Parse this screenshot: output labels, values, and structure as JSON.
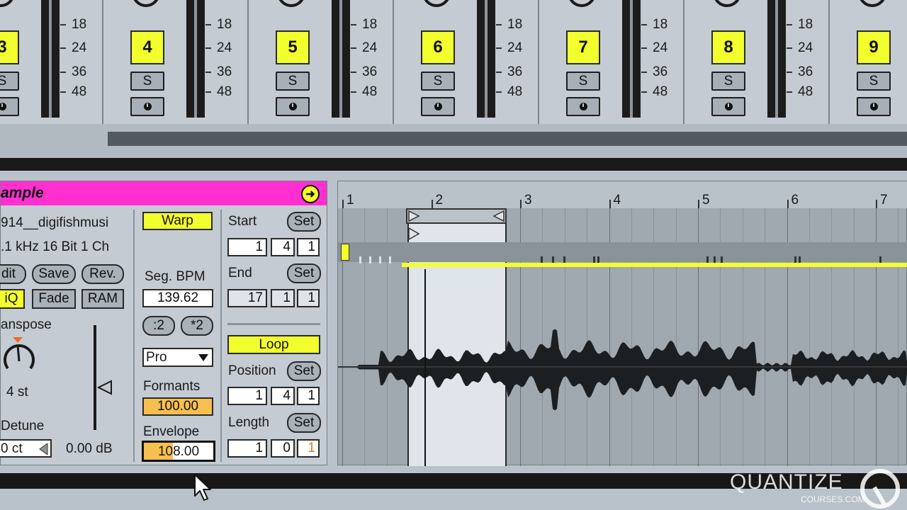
{
  "mixer": {
    "tracks": [
      {
        "number": "3",
        "solo": "S"
      },
      {
        "number": "4",
        "solo": "S"
      },
      {
        "number": "5",
        "solo": "S"
      },
      {
        "number": "6",
        "solo": "S"
      },
      {
        "number": "7",
        "solo": "S"
      },
      {
        "number": "8",
        "solo": "S"
      },
      {
        "number": "9",
        "solo": "S"
      }
    ],
    "meter_scale": [
      "18",
      "24",
      "36",
      "48"
    ]
  },
  "sample": {
    "title": "ample",
    "file_name": "914__digifishmusi",
    "file_info": ".1 kHz 16 Bit 1 Ch",
    "edit_label": "dit",
    "save_label": "Save",
    "rev_label": "Rev.",
    "hiq_label": "iQ",
    "fade_label": "Fade",
    "ram_label": "RAM",
    "transpose_label": "anspose",
    "transpose_value": "4 st",
    "detune_label": "Detune",
    "detune_value": "0 ct",
    "gain_value": "0.00 dB",
    "warp_label": "Warp",
    "seg_bpm_label": "Seg. BPM",
    "seg_bpm_value": "139.62",
    "halve_label": ":2",
    "double_label": "*2",
    "warp_mode": "Pro",
    "formants_label": "Formants",
    "formants_value": "100.00",
    "envelope_label": "Envelope",
    "envelope_value": "108.00",
    "start_label": "Start",
    "start_set": "Set",
    "start_values": [
      "1",
      "4",
      "1"
    ],
    "end_label": "End",
    "end_set": "Set",
    "end_values": [
      "17",
      "1",
      "1"
    ],
    "loop_label": "Loop",
    "position_label": "Position",
    "position_set": "Set",
    "position_values": [
      "1",
      "4",
      "1"
    ],
    "length_label": "Length",
    "length_set": "Set",
    "length_values": [
      "1",
      "0",
      "1"
    ]
  },
  "clip_view": {
    "bars": [
      "1",
      "2",
      "3",
      "4",
      "5",
      "6",
      "7"
    ]
  },
  "brand": {
    "name": "QUANTIZE",
    "site": "COURSES.COM"
  },
  "colors": {
    "accent_yellow": "#f3ff2c",
    "title_magenta": "#ff2fd0",
    "field_orange": "#f7bf4f"
  }
}
